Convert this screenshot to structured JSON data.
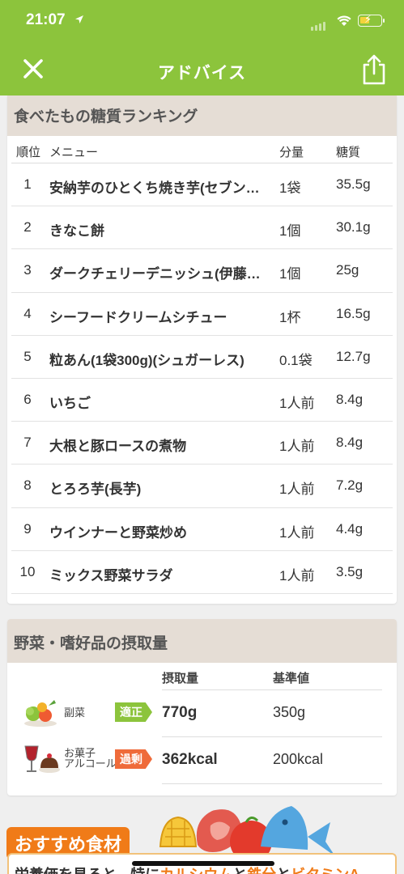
{
  "status_bar": {
    "time": "21:07"
  },
  "nav": {
    "title": "アドバイス",
    "close_icon": "close-icon",
    "share_icon": "share-icon"
  },
  "ranking": {
    "title": "食べたもの糖質ランキング",
    "headers": {
      "rank": "順位",
      "menu": "メニュー",
      "amount": "分量",
      "sugar": "糖質"
    },
    "rows": [
      {
        "rank": "1",
        "menu": "安納芋のひとくち焼き芋(セブンイレブン)",
        "amount": "1袋",
        "sugar": "35.5g"
      },
      {
        "rank": "2",
        "menu": "きなこ餅",
        "amount": "1個",
        "sugar": "30.1g"
      },
      {
        "rank": "3",
        "menu": "ダークチェリーデニッシュ(伊藤製パン)",
        "amount": "1個",
        "sugar": "25g"
      },
      {
        "rank": "4",
        "menu": "シーフードクリームシチュー",
        "amount": "1杯",
        "sugar": "16.5g"
      },
      {
        "rank": "5",
        "menu": "粒あん(1袋300g)(シュガーレス)",
        "amount": "0.1袋",
        "sugar": "12.7g"
      },
      {
        "rank": "6",
        "menu": "いちご",
        "amount": "1人前",
        "sugar": "8.4g"
      },
      {
        "rank": "7",
        "menu": "大根と豚ロースの煮物",
        "amount": "1人前",
        "sugar": "8.4g"
      },
      {
        "rank": "8",
        "menu": "とろろ芋(長芋)",
        "amount": "1人前",
        "sugar": "7.2g"
      },
      {
        "rank": "9",
        "menu": "ウインナーと野菜炒め",
        "amount": "1人前",
        "sugar": "4.4g"
      },
      {
        "rank": "10",
        "menu": "ミックス野菜サラダ",
        "amount": "1人前",
        "sugar": "3.5g"
      }
    ]
  },
  "intake": {
    "title": "野菜・嗜好品の摂取量",
    "headers": {
      "intake": "摂取量",
      "standard": "基準値"
    },
    "rows": [
      {
        "icon": "vegetables-icon",
        "label": "副菜",
        "badge": "適正",
        "badge_color": "#8cc43c",
        "value": "770g",
        "standard": "350g"
      },
      {
        "icon": "sweets-alcohol-icon",
        "label": "お菓子\nアルコール",
        "badge": "過剰",
        "badge_color": "#ef6b3a",
        "value": "362kcal",
        "standard": "200kcal"
      }
    ]
  },
  "recommend": {
    "tag": "おすすめ食材",
    "text_parts": [
      "栄養価を見ると、特に",
      "カルシウム",
      "と",
      "鉄分",
      "と",
      "ビタミンA"
    ]
  },
  "colors": {
    "accent": "#8cc43c",
    "header_bg": "#e5ddd5",
    "orange": "#f07b18"
  }
}
